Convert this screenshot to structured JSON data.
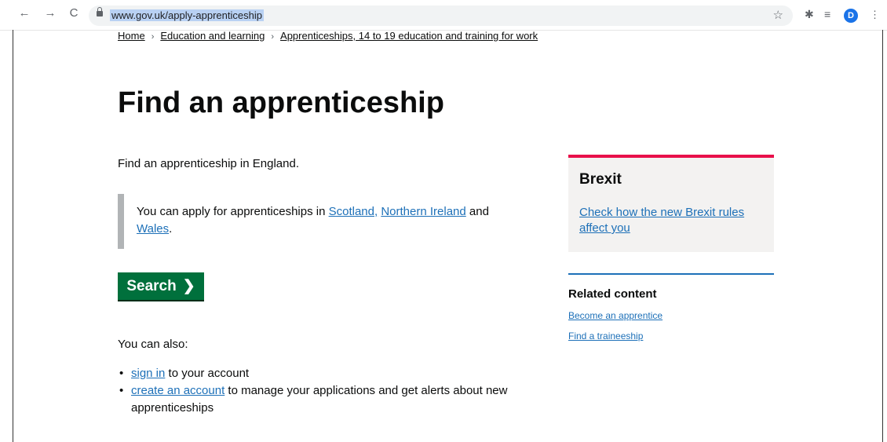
{
  "browser": {
    "back": "←",
    "forward": "→",
    "reload": "C",
    "url": "www.gov.uk/apply-apprenticeship",
    "star": "☆",
    "extensions_icon": "✱",
    "media_icon": "≡",
    "avatar": "D",
    "menu": "⋮"
  },
  "breadcrumb": {
    "items": [
      "Home",
      "Education and learning",
      "Apprenticeships, 14 to 19 education and training for work"
    ],
    "separator": "›"
  },
  "page": {
    "title": "Find an apprenticeship",
    "lede": "Find an apprenticeship in England.",
    "inset": {
      "text_before": "You can apply for apprenticeships in ",
      "link_scotland": "Scotland,",
      "link_ni": "Northern Ireland",
      "text_and": " and",
      "link_wales": "Wales",
      "text_end": "."
    },
    "search_button": "Search",
    "search_chevron": "❯",
    "also": "You can also:",
    "list": {
      "item1_link": "sign in",
      "item1_text": " to your account",
      "item2_link": "create an account",
      "item2_text": " to manage your applications and get alerts about new apprenticeships"
    }
  },
  "sidebar": {
    "brexit_title": "Brexit",
    "brexit_link": "Check how the new Brexit rules affect you",
    "related_title": "Related content",
    "related_links": [
      "Become an apprentice",
      "Find a traineeship"
    ]
  },
  "colors": {
    "link": "#1d70b8",
    "button": "#00703c",
    "brexit_border": "#e8104a",
    "brexit_bg": "#f3f2f1"
  }
}
